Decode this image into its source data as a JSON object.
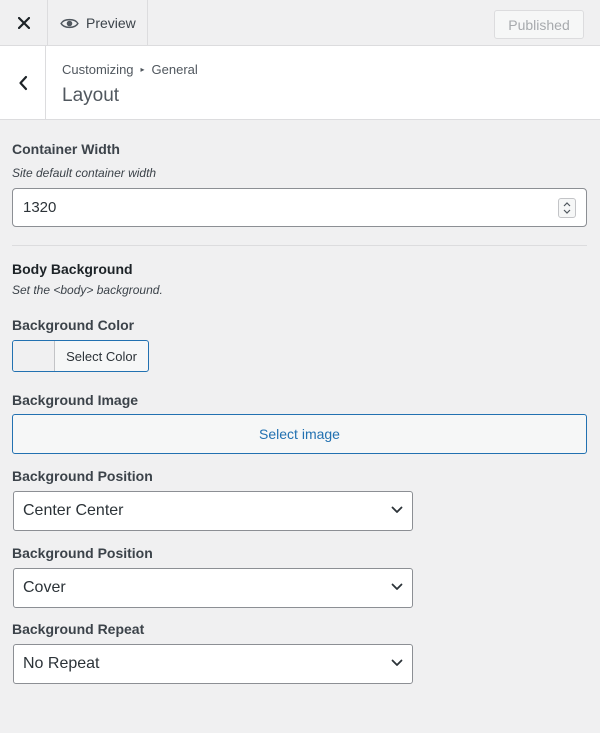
{
  "topbar": {
    "close_icon": "close-icon",
    "preview_label": "Preview",
    "preview_icon": "eye-icon",
    "published_label": "Published"
  },
  "section": {
    "back_icon": "chevron-left-icon",
    "breadcrumb": [
      "Customizing",
      "General"
    ],
    "breadcrumb_separator": "▸",
    "title": "Layout"
  },
  "container_width": {
    "label": "Container Width",
    "description": "Site default container width",
    "value": "1320"
  },
  "body_background": {
    "heading": "Body Background",
    "description": "Set the <body> background.",
    "color": {
      "label": "Background Color",
      "button_label": "Select Color"
    },
    "image": {
      "label": "Background Image",
      "button_label": "Select image"
    },
    "position": {
      "label": "Background Position",
      "selected": "Center Center"
    },
    "size": {
      "label": "Background Position",
      "selected": "Cover"
    },
    "repeat": {
      "label": "Background Repeat",
      "selected": "No Repeat"
    }
  },
  "colors": {
    "accent": "#2271b1",
    "background": "#f0f0f1",
    "text": "#1d2327"
  }
}
